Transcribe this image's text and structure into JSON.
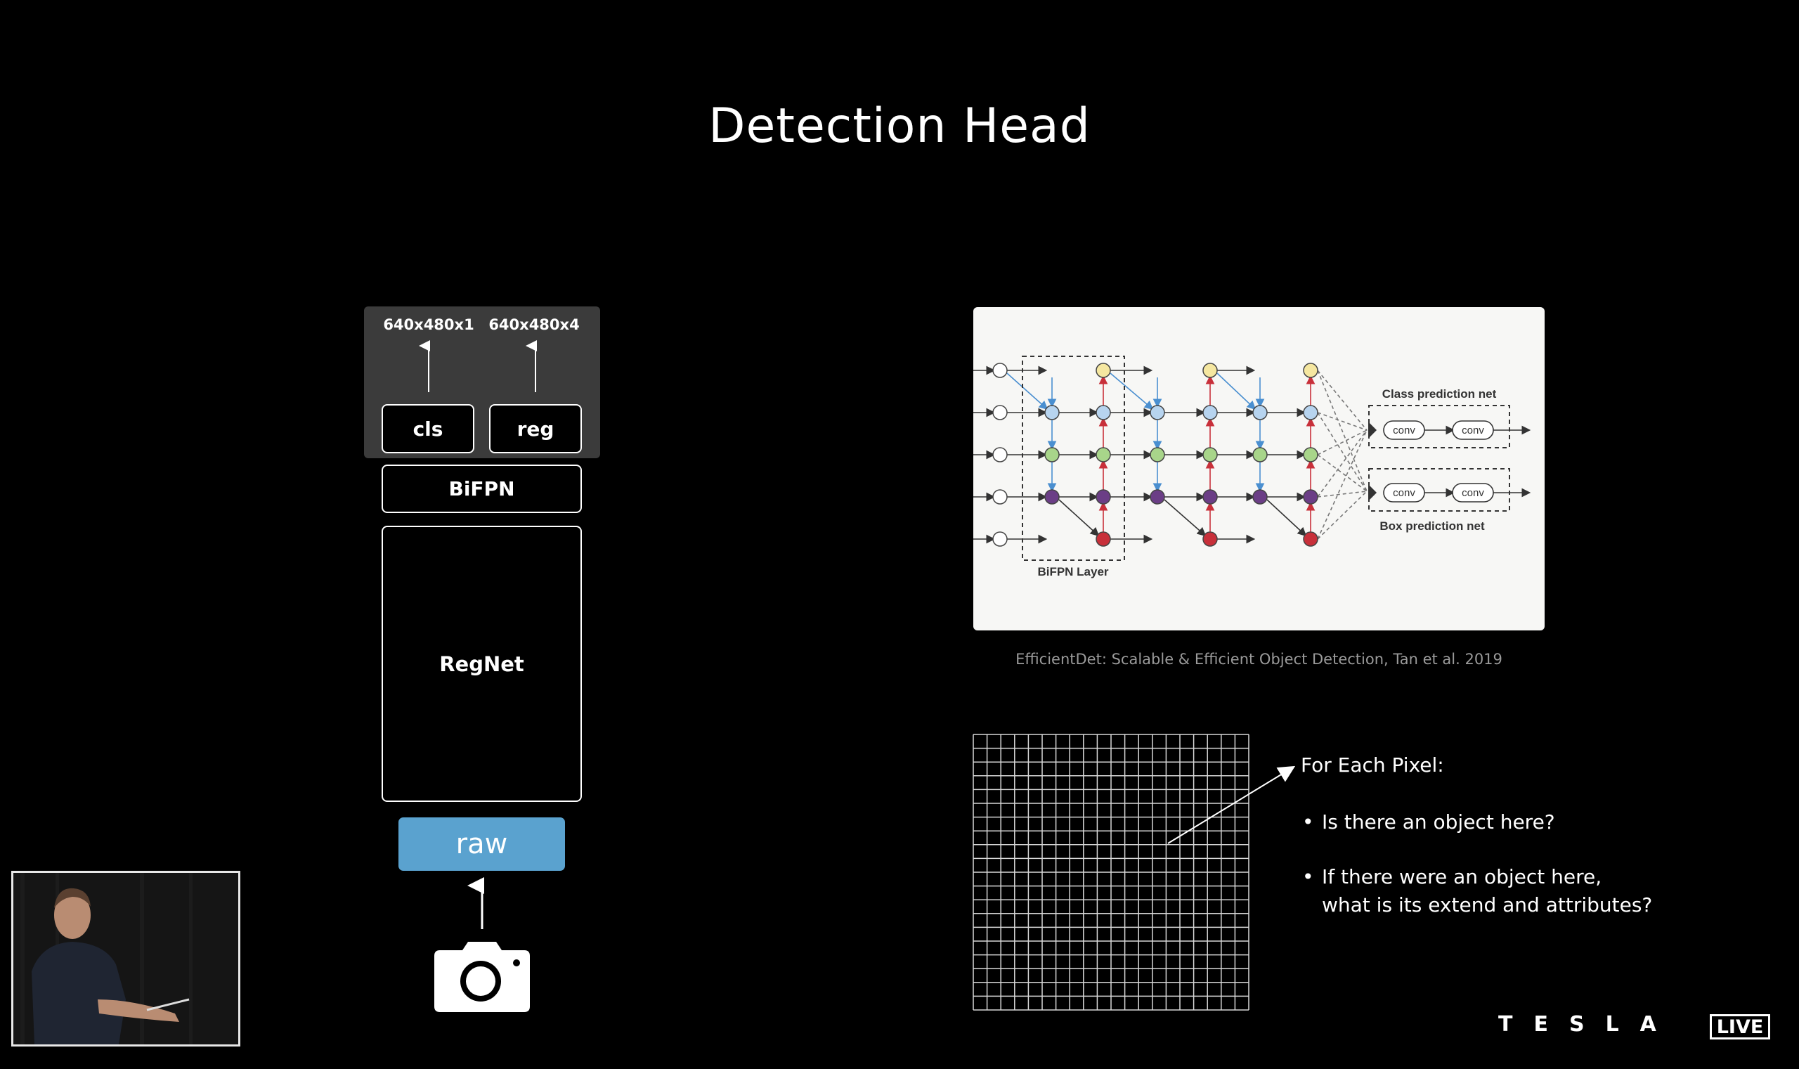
{
  "slide": {
    "title": "Detection Head"
  },
  "network": {
    "cls_output_shape": "640x480x1",
    "reg_output_shape": "640x480x4",
    "cls_label": "cls",
    "reg_label": "reg",
    "bifpn_label": "BiFPN",
    "backbone_label": "RegNet",
    "input_label": "raw",
    "input_color": "#5aa2cf",
    "camera_icon": "camera-icon"
  },
  "figure": {
    "class_net_label": "Class prediction net",
    "box_net_label": "Box prediction net",
    "bifpn_layer_label": "BiFPN Layer",
    "conv_label": "conv",
    "citation": "EfficientDet: Scalable & Efficient Object Detection, Tan et al. 2019",
    "node_colors": {
      "input": "#ffffff",
      "yellow": "#f5e7a0",
      "blue": "#b7d4ef",
      "green": "#a8d58a",
      "purple": "#6b3e86",
      "red": "#c8303a"
    }
  },
  "explanation": {
    "heading": "For Each Pixel:",
    "bullet_1": "Is there an object here?",
    "bullet_2_line1": "If there were an object here,",
    "bullet_2_line2": "what is its extend and attributes?"
  },
  "brand": {
    "wordmark": "TESLA",
    "live_badge": "LIVE"
  }
}
